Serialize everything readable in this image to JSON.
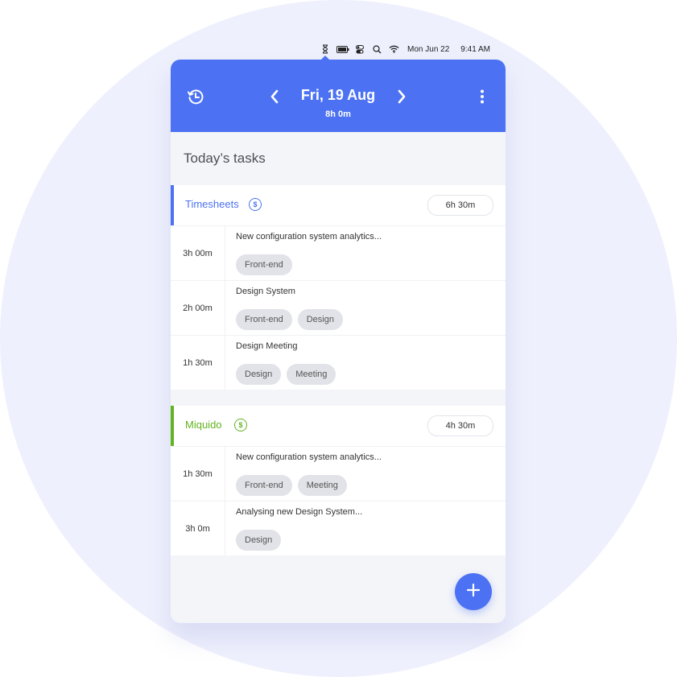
{
  "menubar": {
    "icons": [
      "hourglass-icon",
      "battery-icon",
      "control-center-icon",
      "search-icon",
      "wifi-icon"
    ],
    "date": "Mon Jun 22",
    "time": "9:41 AM"
  },
  "header": {
    "date": "Fri, 19 Aug",
    "total": "8h 0m",
    "icons": {
      "history": "history-icon",
      "prev": "chevron-left-icon",
      "next": "chevron-right-icon",
      "more": "more-vertical-icon"
    },
    "color": "#4c72f3"
  },
  "section_title": "Today’s tasks",
  "projects": [
    {
      "name": "Timesheets",
      "color": "#4c72f3",
      "billable_symbol": "$",
      "total": "6h 30m",
      "tasks": [
        {
          "duration": "3h 00m",
          "title": "New configuration system analytics...",
          "tags": [
            "Front-end"
          ]
        },
        {
          "duration": "2h 00m",
          "title": "Design System",
          "tags": [
            "Front-end",
            "Design"
          ]
        },
        {
          "duration": "1h 30m",
          "title": "Design Meeting",
          "tags": [
            "Design",
            "Meeting"
          ]
        }
      ]
    },
    {
      "name": "Miquido",
      "color": "#62b420",
      "billable_symbol": "$",
      "total": "4h 30m",
      "tasks": [
        {
          "duration": "1h 30m",
          "title": "New configuration system analytics...",
          "tags": [
            "Front-end",
            "Meeting"
          ]
        },
        {
          "duration": "3h 0m",
          "title": "Analysing new Design System...",
          "tags": [
            "Design"
          ]
        }
      ]
    }
  ],
  "fab": {
    "icon": "plus-icon",
    "label": "+"
  }
}
